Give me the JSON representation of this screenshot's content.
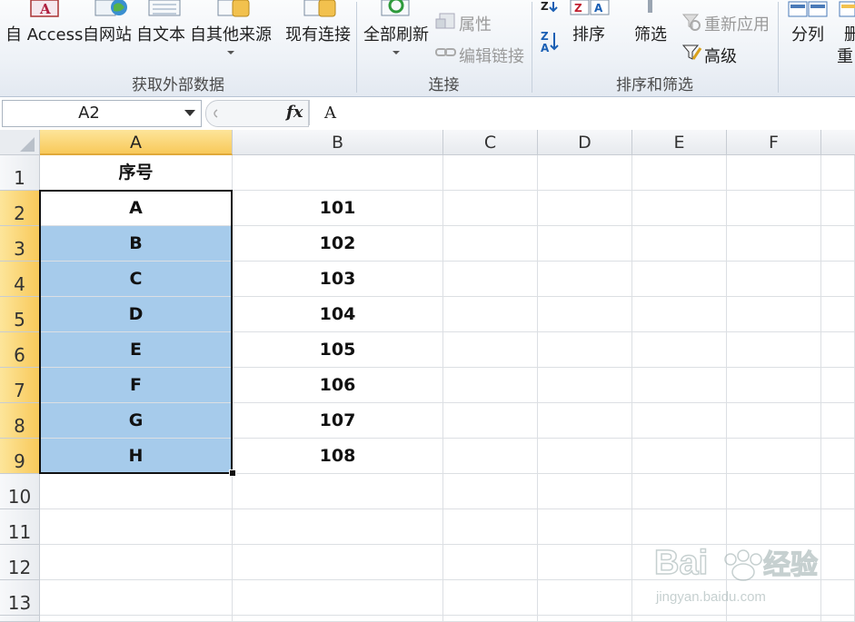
{
  "ribbon": {
    "external_data": {
      "group_label": "获取外部数据",
      "buttons": [
        "自 Access",
        "自网站",
        "自文本",
        "自其他来源",
        "现有连接"
      ]
    },
    "connections": {
      "group_label": "连接",
      "refresh_all": "全部刷新",
      "properties": "属性",
      "edit_links": "编辑链接"
    },
    "sort_filter": {
      "group_label": "排序和筛选",
      "sort": "排序",
      "filter": "筛选",
      "reapply": "重新应用",
      "advanced": "高级"
    },
    "data_tools": {
      "text_to_columns": "分列",
      "remove_duplicates_partial_1": "删",
      "remove_duplicates_partial_2": "重"
    }
  },
  "formula_bar": {
    "name_box": "A2",
    "fx_label": "fx",
    "formula": "A"
  },
  "sheet": {
    "columns": [
      "A",
      "B",
      "C",
      "D",
      "E",
      "F"
    ],
    "rows": [
      "1",
      "2",
      "3",
      "4",
      "5",
      "6",
      "7",
      "8",
      "9",
      "10",
      "11",
      "12",
      "13"
    ],
    "cells": [
      [
        "序号",
        ""
      ],
      [
        "A",
        "101"
      ],
      [
        "B",
        "102"
      ],
      [
        "C",
        "103"
      ],
      [
        "D",
        "104"
      ],
      [
        "E",
        "105"
      ],
      [
        "F",
        "106"
      ],
      [
        "G",
        "107"
      ],
      [
        "H",
        "108"
      ]
    ]
  },
  "watermark": {
    "brand": "Bai",
    "brand_cn": "经验",
    "url": "jingyan.baidu.com"
  },
  "colors": {
    "selection_fill": "#a6cbeb",
    "header_selected": "#f8c95a"
  }
}
